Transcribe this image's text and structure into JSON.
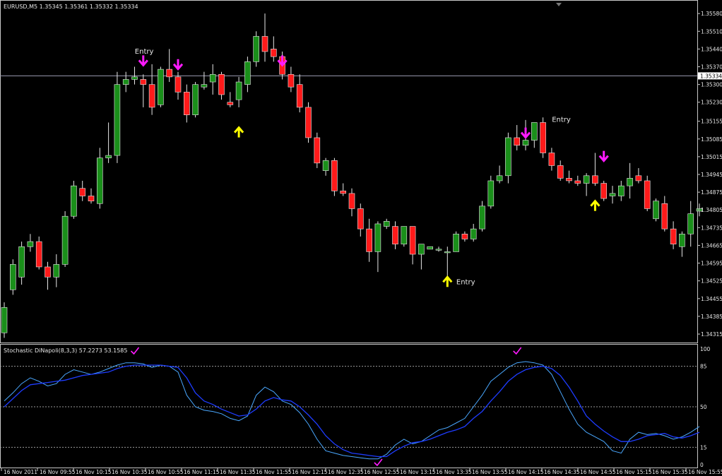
{
  "chart_data": [
    {
      "type": "candlestick",
      "title": "EURUSD,M5  1.35345 1.35361 1.35332 1.35334",
      "symbol": "EURUSD",
      "timeframe": "M5",
      "ylim": [
        1.3429,
        1.356
      ],
      "current_price": 1.35334,
      "current_price_label": "1.35334",
      "y_ticks": [
        "1.35580",
        "1.35510",
        "1.35440",
        "1.35370",
        "1.35300",
        "1.35230",
        "1.35155",
        "1.35085",
        "1.35015",
        "1.34945",
        "1.34875",
        "1.34805",
        "1.34735",
        "1.34665",
        "1.34595",
        "1.34525",
        "1.34455",
        "1.34385",
        "1.34315"
      ],
      "x_ticks": [
        "16 Nov 2011",
        "16 Nov 09:55",
        "16 Nov 10:15",
        "16 Nov 10:35",
        "16 Nov 10:55",
        "16 Nov 11:15",
        "16 Nov 11:35",
        "16 Nov 11:55",
        "16 Nov 12:15",
        "16 Nov 12:35",
        "16 Nov 12:55",
        "16 Nov 13:15",
        "16 Nov 13:35",
        "16 Nov 13:55",
        "16 Nov 14:15",
        "16 Nov 14:35",
        "16 Nov 14:55",
        "16 Nov 15:15",
        "16 Nov 15:35",
        "16 Nov 15:55"
      ],
      "candles": [
        [
          1.3432,
          1.3444,
          1.343,
          1.3442
        ],
        [
          1.3449,
          1.3461,
          1.3447,
          1.3459
        ],
        [
          1.3454,
          1.3468,
          1.3451,
          1.3466
        ],
        [
          1.3466,
          1.3471,
          1.3464,
          1.3468
        ],
        [
          1.3468,
          1.347,
          1.3457,
          1.3458
        ],
        [
          1.3458,
          1.346,
          1.3449,
          1.3454
        ],
        [
          1.3454,
          1.3463,
          1.345,
          1.3459
        ],
        [
          1.3459,
          1.348,
          1.3458,
          1.3478
        ],
        [
          1.3478,
          1.3492,
          1.3477,
          1.349
        ],
        [
          1.3489,
          1.3492,
          1.3484,
          1.3486
        ],
        [
          1.3486,
          1.3489,
          1.3483,
          1.3484
        ],
        [
          1.3483,
          1.3505,
          1.3481,
          1.3501
        ],
        [
          1.3501,
          1.3515,
          1.3499,
          1.3502
        ],
        [
          1.3502,
          1.3535,
          1.3499,
          1.353
        ],
        [
          1.353,
          1.3535,
          1.3527,
          1.3532
        ],
        [
          1.3532,
          1.3537,
          1.353,
          1.3533
        ],
        [
          1.3532,
          1.3534,
          1.3521,
          1.353
        ],
        [
          1.353,
          1.3538,
          1.3518,
          1.3521
        ],
        [
          1.3522,
          1.3537,
          1.3521,
          1.3536
        ],
        [
          1.3536,
          1.3544,
          1.3531,
          1.3533
        ],
        [
          1.3533,
          1.3535,
          1.3524,
          1.3527
        ],
        [
          1.3527,
          1.353,
          1.3515,
          1.3518
        ],
        [
          1.3518,
          1.3531,
          1.3517,
          1.353
        ],
        [
          1.3529,
          1.3535,
          1.3528,
          1.353
        ],
        [
          1.3531,
          1.3538,
          1.3526,
          1.3534
        ],
        [
          1.3534,
          1.3535,
          1.3524,
          1.3526
        ],
        [
          1.3523,
          1.3527,
          1.3521,
          1.3522
        ],
        [
          1.3524,
          1.3533,
          1.3521,
          1.3531
        ],
        [
          1.353,
          1.3541,
          1.3527,
          1.3539
        ],
        [
          1.3539,
          1.3551,
          1.3537,
          1.3549
        ],
        [
          1.3549,
          1.3558,
          1.3539,
          1.3543
        ],
        [
          1.3544,
          1.3549,
          1.3539,
          1.3541
        ],
        [
          1.3541,
          1.3543,
          1.3532,
          1.3534
        ],
        [
          1.3534,
          1.3537,
          1.3527,
          1.3529
        ],
        [
          1.353,
          1.3534,
          1.3519,
          1.3521
        ],
        [
          1.3521,
          1.3523,
          1.3507,
          1.3509
        ],
        [
          1.3509,
          1.3511,
          1.3497,
          1.3499
        ],
        [
          1.3496,
          1.3501,
          1.3494,
          1.35
        ],
        [
          1.35,
          1.3501,
          1.3486,
          1.3488
        ],
        [
          1.3488,
          1.3491,
          1.3486,
          1.3487
        ],
        [
          1.3487,
          1.3489,
          1.3478,
          1.3481
        ],
        [
          1.3481,
          1.3483,
          1.347,
          1.3473
        ],
        [
          1.3473,
          1.3477,
          1.346,
          1.3464
        ],
        [
          1.3464,
          1.3476,
          1.3456,
          1.3475
        ],
        [
          1.3474,
          1.3477,
          1.3473,
          1.3476
        ],
        [
          1.3474,
          1.3476,
          1.3465,
          1.3467
        ],
        [
          1.3467,
          1.3474,
          1.3466,
          1.3474
        ],
        [
          1.3474,
          1.3474,
          1.3459,
          1.3463
        ],
        [
          1.3463,
          1.3467,
          1.3457,
          1.3467
        ],
        [
          1.3465,
          1.3466,
          1.3465,
          1.3466
        ],
        [
          1.3465,
          1.3466,
          1.3464,
          1.3465
        ],
        [
          1.3464,
          1.3466,
          1.3453,
          1.3464
        ],
        [
          1.3464,
          1.3472,
          1.3464,
          1.3471
        ],
        [
          1.3471,
          1.3472,
          1.3468,
          1.3469
        ],
        [
          1.3469,
          1.3475,
          1.3468,
          1.3473
        ],
        [
          1.3473,
          1.3484,
          1.3472,
          1.3482
        ],
        [
          1.3482,
          1.3494,
          1.3481,
          1.3492
        ],
        [
          1.3492,
          1.3498,
          1.3491,
          1.3494
        ],
        [
          1.3494,
          1.3511,
          1.3491,
          1.3509
        ],
        [
          1.3509,
          1.3514,
          1.3504,
          1.3506
        ],
        [
          1.3506,
          1.3516,
          1.3504,
          1.3508
        ],
        [
          1.3508,
          1.3515,
          1.3505,
          1.3515
        ],
        [
          1.3515,
          1.3517,
          1.3501,
          1.3503
        ],
        [
          1.3503,
          1.3505,
          1.3496,
          1.3498
        ],
        [
          1.3498,
          1.35,
          1.3492,
          1.3493
        ],
        [
          1.3493,
          1.3496,
          1.3491,
          1.3492
        ],
        [
          1.3492,
          1.3494,
          1.349,
          1.3491
        ],
        [
          1.3491,
          1.3495,
          1.3486,
          1.3494
        ],
        [
          1.3494,
          1.3503,
          1.349,
          1.3491
        ],
        [
          1.3491,
          1.3492,
          1.3484,
          1.3485
        ],
        [
          1.3486,
          1.349,
          1.3483,
          1.3487
        ],
        [
          1.3486,
          1.3492,
          1.3484,
          1.349
        ],
        [
          1.349,
          1.3499,
          1.3485,
          1.3493
        ],
        [
          1.3494,
          1.3497,
          1.3491,
          1.3492
        ],
        [
          1.3492,
          1.3494,
          1.348,
          1.3481
        ],
        [
          1.3477,
          1.3485,
          1.3476,
          1.3484
        ],
        [
          1.3483,
          1.3486,
          1.3472,
          1.3473
        ],
        [
          1.3473,
          1.3476,
          1.3465,
          1.3467
        ],
        [
          1.3466,
          1.3472,
          1.3462,
          1.3471
        ],
        [
          1.3471,
          1.3484,
          1.3466,
          1.3479
        ],
        [
          1.348,
          1.3483,
          1.3478,
          1.3481
        ]
      ],
      "colors": {
        "bull": "#1a8f1a",
        "bear": "#ff1a1a",
        "wick": "#e8e8e8",
        "hline": "#9a9ab0"
      },
      "annotations": [
        {
          "type": "text",
          "label": "Entry",
          "candle": 16,
          "price": 1.35422
        },
        {
          "type": "text",
          "label": "Entry",
          "candle": 53,
          "price": 1.34512
        },
        {
          "type": "text",
          "label": "Entry",
          "candle": 64,
          "price": 1.35152
        },
        {
          "type": "arrow-down",
          "color": "#ff1aff",
          "candle": 16,
          "price": 1.35415
        },
        {
          "type": "arrow-down",
          "color": "#ff1aff",
          "candle": 20,
          "price": 1.354
        },
        {
          "type": "arrow-down",
          "color": "#ff1aff",
          "candle": 32,
          "price": 1.35415
        },
        {
          "type": "arrow-down",
          "color": "#ff1aff",
          "candle": 60,
          "price": 1.3513
        },
        {
          "type": "arrow-down",
          "color": "#ff1aff",
          "candle": 69,
          "price": 1.35038
        },
        {
          "type": "arrow-up",
          "color": "#ffff00",
          "candle": 27,
          "price": 1.3513
        },
        {
          "type": "arrow-up",
          "color": "#ffff00",
          "candle": 51,
          "price": 1.3454
        },
        {
          "type": "arrow-up",
          "color": "#ffff00",
          "candle": 68,
          "price": 1.3484
        }
      ]
    },
    {
      "type": "line",
      "title": "Stochastic DiNapoli(8,3,3) 57.2273 53.1585",
      "ylim": [
        0,
        100
      ],
      "y_ticks": [
        "100",
        "85",
        "50",
        "15",
        "0"
      ],
      "levels": [
        85,
        50,
        15
      ],
      "series": [
        {
          "color": "#4aa8ff",
          "values": [
            55,
            62,
            70,
            75,
            72,
            68,
            70,
            78,
            82,
            80,
            78,
            80,
            83,
            86,
            88,
            88,
            87,
            84,
            86,
            85,
            80,
            60,
            50,
            47,
            46,
            44,
            40,
            38,
            42,
            60,
            67,
            63,
            55,
            52,
            45,
            35,
            22,
            12,
            10,
            8,
            7,
            6,
            5,
            5,
            9,
            17,
            22,
            18,
            20,
            25,
            30,
            32,
            36,
            40,
            50,
            60,
            72,
            78,
            84,
            88,
            89,
            88,
            86,
            78,
            63,
            48,
            35,
            28,
            24,
            20,
            12,
            10,
            22,
            28,
            26,
            27,
            25,
            22,
            24,
            28,
            33
          ]
        },
        {
          "color": "#1e3cff",
          "values": [
            50,
            57,
            64,
            69,
            70,
            71,
            72,
            73,
            75,
            77,
            78,
            79,
            80,
            83,
            85,
            86,
            86,
            86,
            86,
            85,
            84,
            75,
            62,
            55,
            52,
            48,
            45,
            42,
            43,
            48,
            55,
            58,
            56,
            55,
            50,
            43,
            35,
            25,
            18,
            13,
            10,
            9,
            8,
            7,
            7,
            12,
            16,
            19,
            20,
            22,
            25,
            28,
            30,
            33,
            40,
            46,
            55,
            63,
            72,
            78,
            82,
            84,
            85,
            83,
            77,
            67,
            55,
            42,
            35,
            29,
            24,
            20,
            20,
            22,
            25,
            26,
            27,
            24,
            23,
            25,
            28
          ]
        }
      ],
      "markers": [
        {
          "type": "check",
          "color": "#ff1aff",
          "index": 15,
          "value": 88
        },
        {
          "type": "check",
          "color": "#ff1aff",
          "index": 59,
          "value": 88
        },
        {
          "type": "check",
          "color": "#ff1aff",
          "index": 43,
          "value": 5
        }
      ]
    }
  ]
}
